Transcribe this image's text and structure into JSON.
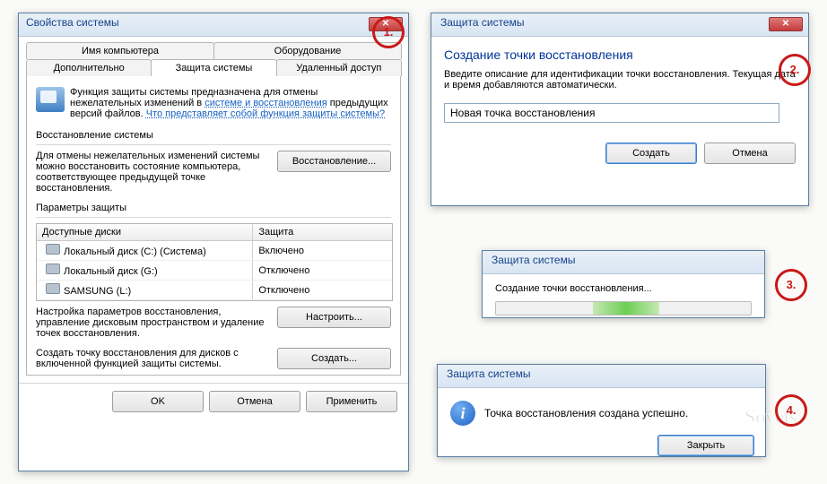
{
  "marks": {
    "m1": "1.",
    "m2": "2.",
    "m3": "3.",
    "m4": "4."
  },
  "w1": {
    "title": "Свойства системы",
    "tabs_row1": [
      "Имя компьютера",
      "Оборудование"
    ],
    "tabs_row2": [
      "Дополнительно",
      "Защита системы",
      "Удаленный доступ"
    ],
    "active_tab": "Защита системы",
    "intro_a": "Функция защиты системы предназначена для отмены нежелательных изменений в ",
    "intro_link1": "системе и восстановления",
    "intro_b": " предыдущих версий файлов. ",
    "intro_link2": "Что представляет собой функция защиты системы?",
    "group_restore": "Восстановление системы",
    "restore_text": "Для отмены нежелательных изменений системы можно восстановить состояние компьютера, соответствующее предыдущей точке восстановления.",
    "btn_restore": "Восстановление...",
    "group_params": "Параметры защиты",
    "col1": "Доступные диски",
    "col2": "Защита",
    "disks": [
      {
        "name": "Локальный диск (C:) (Система)",
        "state": "Включено"
      },
      {
        "name": "Локальный диск (G:)",
        "state": "Отключено"
      },
      {
        "name": "SAMSUNG (L:)",
        "state": "Отключено"
      }
    ],
    "cfg_text": "Настройка параметров восстановления, управление дисковым пространством и удаление точек восстановления.",
    "btn_cfg": "Настроить...",
    "create_text": "Создать точку восстановления для дисков с включенной функцией защиты системы.",
    "btn_create": "Создать...",
    "ok": "OK",
    "cancel": "Отмена",
    "apply": "Применить"
  },
  "w2": {
    "title": "Защита системы",
    "heading": "Создание точки восстановления",
    "desc": "Введите описание для идентификации точки восстановления. Текущая дата и время добавляются автоматически.",
    "input_value": "Новая точка восстановления",
    "btn_create": "Создать",
    "btn_cancel": "Отмена"
  },
  "w3": {
    "title": "Защита системы",
    "text": "Создание точки восстановления..."
  },
  "w4": {
    "title": "Защита системы",
    "text": "Точка восстановления создана успешно.",
    "btn_close": "Закрыть"
  }
}
